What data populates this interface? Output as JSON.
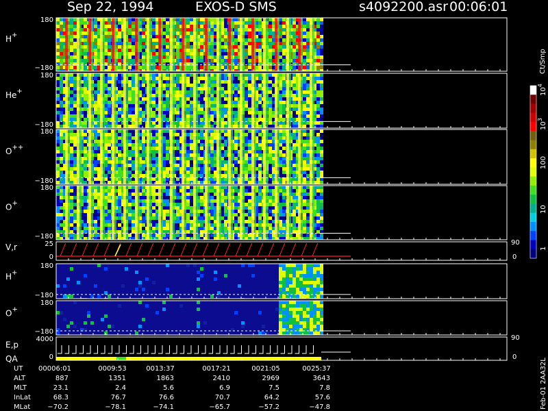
{
  "header": {
    "date": "Sep 22, 1994",
    "instrument": "EXOS-D SMS",
    "file": "s4092200.asr",
    "time": "00:06:01"
  },
  "colors": {
    "background": "#000000",
    "plot_border": "#ffffff",
    "trace_red": "#ff2020",
    "trace_yellow": "#ffff40",
    "dashed_line": "#ffffff"
  },
  "chart_data": {
    "type": "heatmap",
    "colorbar": {
      "unit": "Ct/Smp",
      "ticks": [
        "1",
        "10",
        "100",
        "10^3",
        "10^4"
      ],
      "tick_labels": [
        {
          "base": "1",
          "exp": ""
        },
        {
          "base": "10",
          "exp": ""
        },
        {
          "base": "100",
          "exp": ""
        },
        {
          "base": "10",
          "exp": "3"
        },
        {
          "base": "10",
          "exp": "4"
        }
      ],
      "colors": [
        "#000080",
        "#0000c0",
        "#0040ff",
        "#0090ff",
        "#00d0e0",
        "#00b090",
        "#10c040",
        "#40e020",
        "#90f000",
        "#e0ff00",
        "#ffff00",
        "#d0c000",
        "#908000",
        "#706010",
        "#ff0000",
        "#d00000",
        "#a00000",
        "#700000",
        "#ffffff"
      ]
    },
    "time_range": [
      "00:06:01",
      "00:25:37"
    ],
    "data_end_time": "00:25:37",
    "panels": [
      {
        "id": "h-plus",
        "label": "H",
        "charge": "+",
        "ymax": "180",
        "ymin": "−180",
        "palette": "rich",
        "spikes": 22
      },
      {
        "id": "he-plus",
        "label": "He",
        "charge": "+",
        "ymax": "180",
        "ymin": "−180",
        "palette": "mixed",
        "spikes": 22
      },
      {
        "id": "o-plusplus",
        "label": "O",
        "charge": "++",
        "ymax": "180",
        "ymin": "−180",
        "palette": "mixed",
        "spikes": 22
      },
      {
        "id": "o-plus",
        "label": "O",
        "charge": "+",
        "ymax": "180",
        "ymin": "−180",
        "palette": "mixed",
        "spikes": 22
      },
      {
        "id": "vr",
        "label": "V,r",
        "ymax": "25",
        "ymin": "0",
        "right_top": "90",
        "right_bottom": "0"
      },
      {
        "id": "h-plus-2",
        "label": "H",
        "charge": "+",
        "ymax": "180",
        "ymin": "−180",
        "palette": "blue"
      },
      {
        "id": "o-plus-2",
        "label": "O",
        "charge": "+",
        "ymax": "180",
        "ymin": "−180",
        "palette": "blue"
      },
      {
        "id": "ep-qa",
        "label": "E,p",
        "label2": "QA",
        "ymax": "4000",
        "ymin": "0",
        "right_top": "90",
        "right_bottom": "0"
      }
    ],
    "ephemeris": {
      "row_labels": [
        "UT",
        "ALT",
        "MLT",
        "InLat",
        "MLat"
      ],
      "columns": [
        [
          "00006:01",
          "887",
          "23.1",
          "68.3",
          "−70.2"
        ],
        [
          "0009:53",
          "1351",
          "2.4",
          "76.7",
          "−78.1"
        ],
        [
          "0013:37",
          "1863",
          "5.6",
          "76.6",
          "−74.1"
        ],
        [
          "0017:21",
          "2410",
          "6.9",
          "70.7",
          "−65.7"
        ],
        [
          "0021:05",
          "2969",
          "7.5",
          "64.2",
          "−57.2"
        ],
        [
          "0025:37",
          "3643",
          "7.8",
          "57.6",
          "−47.8"
        ]
      ]
    },
    "footer": "Feb-01 2AA32L"
  }
}
